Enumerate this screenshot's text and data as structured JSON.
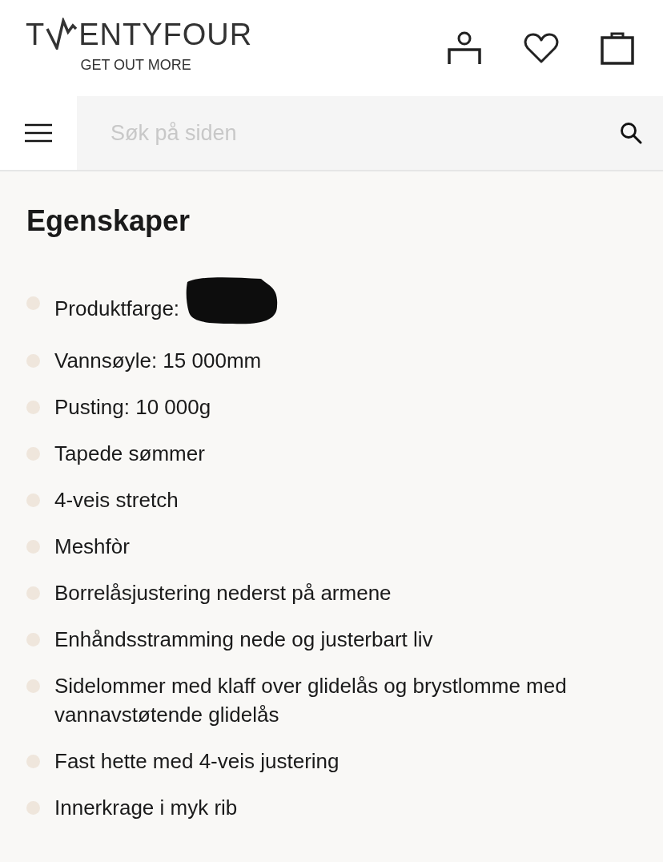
{
  "logo": {
    "before_mark": "T",
    "after_mark": "ENTYFOUR",
    "tagline": "GET OUT MORE"
  },
  "search": {
    "placeholder": "Søk på siden"
  },
  "section": {
    "title": "Egenskaper",
    "items": [
      {
        "text": "Produktfarge:",
        "redacted": true
      },
      {
        "text": "Vannsøyle: 15 000mm",
        "redacted": false
      },
      {
        "text": "Pusting: 10 000g",
        "redacted": false
      },
      {
        "text": "Tapede sømmer",
        "redacted": false
      },
      {
        "text": "4-veis stretch",
        "redacted": false
      },
      {
        "text": "Meshfòr",
        "redacted": false
      },
      {
        "text": "Borrelåsjustering nederst på armene",
        "redacted": false
      },
      {
        "text": "Enhåndsstramming nede og justerbart liv",
        "redacted": false
      },
      {
        "text": "Sidelommer med klaff over glidelås og brystlomme med vannavstøtende glidelås",
        "redacted": false
      },
      {
        "text": "Fast hette med 4-veis justering",
        "redacted": false
      },
      {
        "text": "Innerkrage i myk rib",
        "redacted": false
      }
    ]
  }
}
